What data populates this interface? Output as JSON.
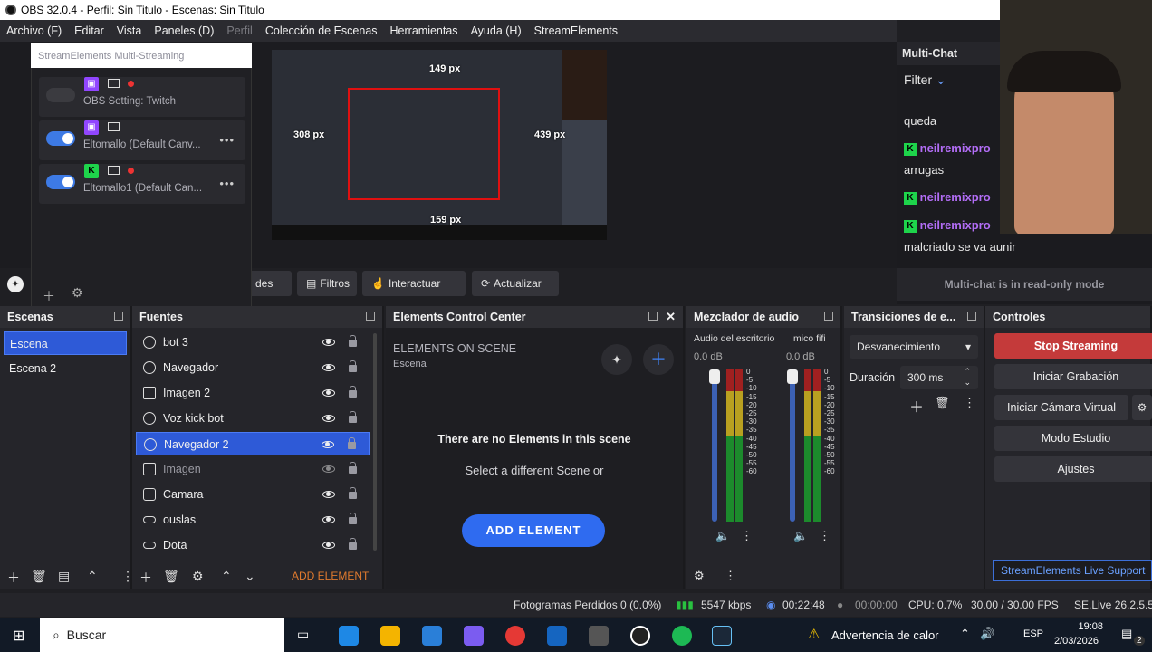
{
  "window": {
    "title": "OBS 32.0.4 - Perfil: Sin Titulo - Escenas: Sin Titulo"
  },
  "menu": [
    "Archivo (F)",
    "Editar",
    "Vista",
    "Paneles (D)",
    "Perfil",
    "Colección de Escenas",
    "Herramientas",
    "Ayuda (H)",
    "StreamElements"
  ],
  "preview": {
    "labels": [
      "149 px",
      "308 px",
      "439 px",
      "159 px"
    ]
  },
  "se_multistream": {
    "title": "StreamElements Multi-Streaming",
    "rows": [
      {
        "name": "OBS Setting: Twitch",
        "platform": "twitch",
        "enabled": false
      },
      {
        "name": "Eltomallo (Default Canv...",
        "platform": "twitch",
        "enabled": true
      },
      {
        "name": "Eltomallo1 (Default Can...",
        "platform": "kick",
        "enabled": true
      }
    ]
  },
  "toolbar": {
    "propiedades": "des",
    "filtros": "Filtros",
    "interactuar": "Interactuar",
    "actualizar": "Actualizar"
  },
  "escenas": {
    "title": "Escenas",
    "items": [
      "Escena",
      "Escena 2"
    ]
  },
  "fuentes": {
    "title": "Fuentes",
    "items": [
      {
        "label": "bot 3",
        "icon": "globe-icon"
      },
      {
        "label": "Navegador",
        "icon": "globe-icon"
      },
      {
        "label": "Imagen 2",
        "icon": "image-icon"
      },
      {
        "label": "Voz kick bot",
        "icon": "globe-icon"
      },
      {
        "label": "Navegador 2",
        "icon": "globe-icon",
        "selected": true
      },
      {
        "label": "Imagen",
        "icon": "image-icon",
        "hidden": true
      },
      {
        "label": "Camara",
        "icon": "camera-icon"
      },
      {
        "label": "ouslas",
        "icon": "link-icon"
      },
      {
        "label": "Dota",
        "icon": "link-icon"
      }
    ],
    "add_element": "ADD ELEMENT"
  },
  "ecc": {
    "title": "Elements Control Center",
    "on_scene": "ELEMENTS ON SCENE",
    "scene": "Escena",
    "empty_title": "There are no Elements in this scene",
    "empty_sub": "Select a different Scene or",
    "add_button": "ADD ELEMENT"
  },
  "mixer": {
    "title": "Mezclador de audio",
    "channels": [
      {
        "name": "Audio del escritorio",
        "db": "0.0 dB"
      },
      {
        "name": "mico fifi",
        "db": "0.0 dB"
      }
    ],
    "scale": [
      "0",
      "-5",
      "-10",
      "-15",
      "-20",
      "-25",
      "-30",
      "-35",
      "-40",
      "-45",
      "-50",
      "-55",
      "-60"
    ]
  },
  "transitions": {
    "title": "Transiciones de e...",
    "selected": "Desvanecimiento",
    "duration_label": "Duración",
    "duration_value": "300 ms"
  },
  "controls": {
    "title": "Controles",
    "buttons": [
      "Stop Streaming",
      "Iniciar Grabación",
      "Iniciar Cámara Virtual",
      "Modo Estudio",
      "Ajustes"
    ],
    "support": "StreamElements Live Support"
  },
  "multichat": {
    "title": "Multi-Chat",
    "filter": "Filter",
    "messages": [
      {
        "user": "",
        "text": "queda"
      },
      {
        "user": "neilremixpro",
        "text": "arrugas"
      },
      {
        "user": "neilremixpro",
        "text": ""
      },
      {
        "user": "neilremixpro",
        "text": "malcriado se va aunir"
      }
    ],
    "readonly": "Multi-chat is in read-only mode"
  },
  "status": {
    "dropped": "Fotogramas Perdidos 0 (0.0%)",
    "kbps": "5547 kbps",
    "live_time": "00:22:48",
    "rec_time": "00:00:00",
    "cpu": "CPU: 0.7%",
    "fps": "30.00 / 30.00 FPS",
    "se": "SE.Live 26.2.5.54"
  },
  "taskbar": {
    "search": "Buscar",
    "warning": "Advertencia de calor",
    "lang": "ESP",
    "time": "19:08",
    "date": "2/03/2026",
    "notif": "2"
  },
  "colors": {
    "accent": "#2e5ad7",
    "stop": "#c43a3a",
    "twitch": "#9146ff",
    "kick": "#1ed44b",
    "add": "#2f6bf0"
  }
}
